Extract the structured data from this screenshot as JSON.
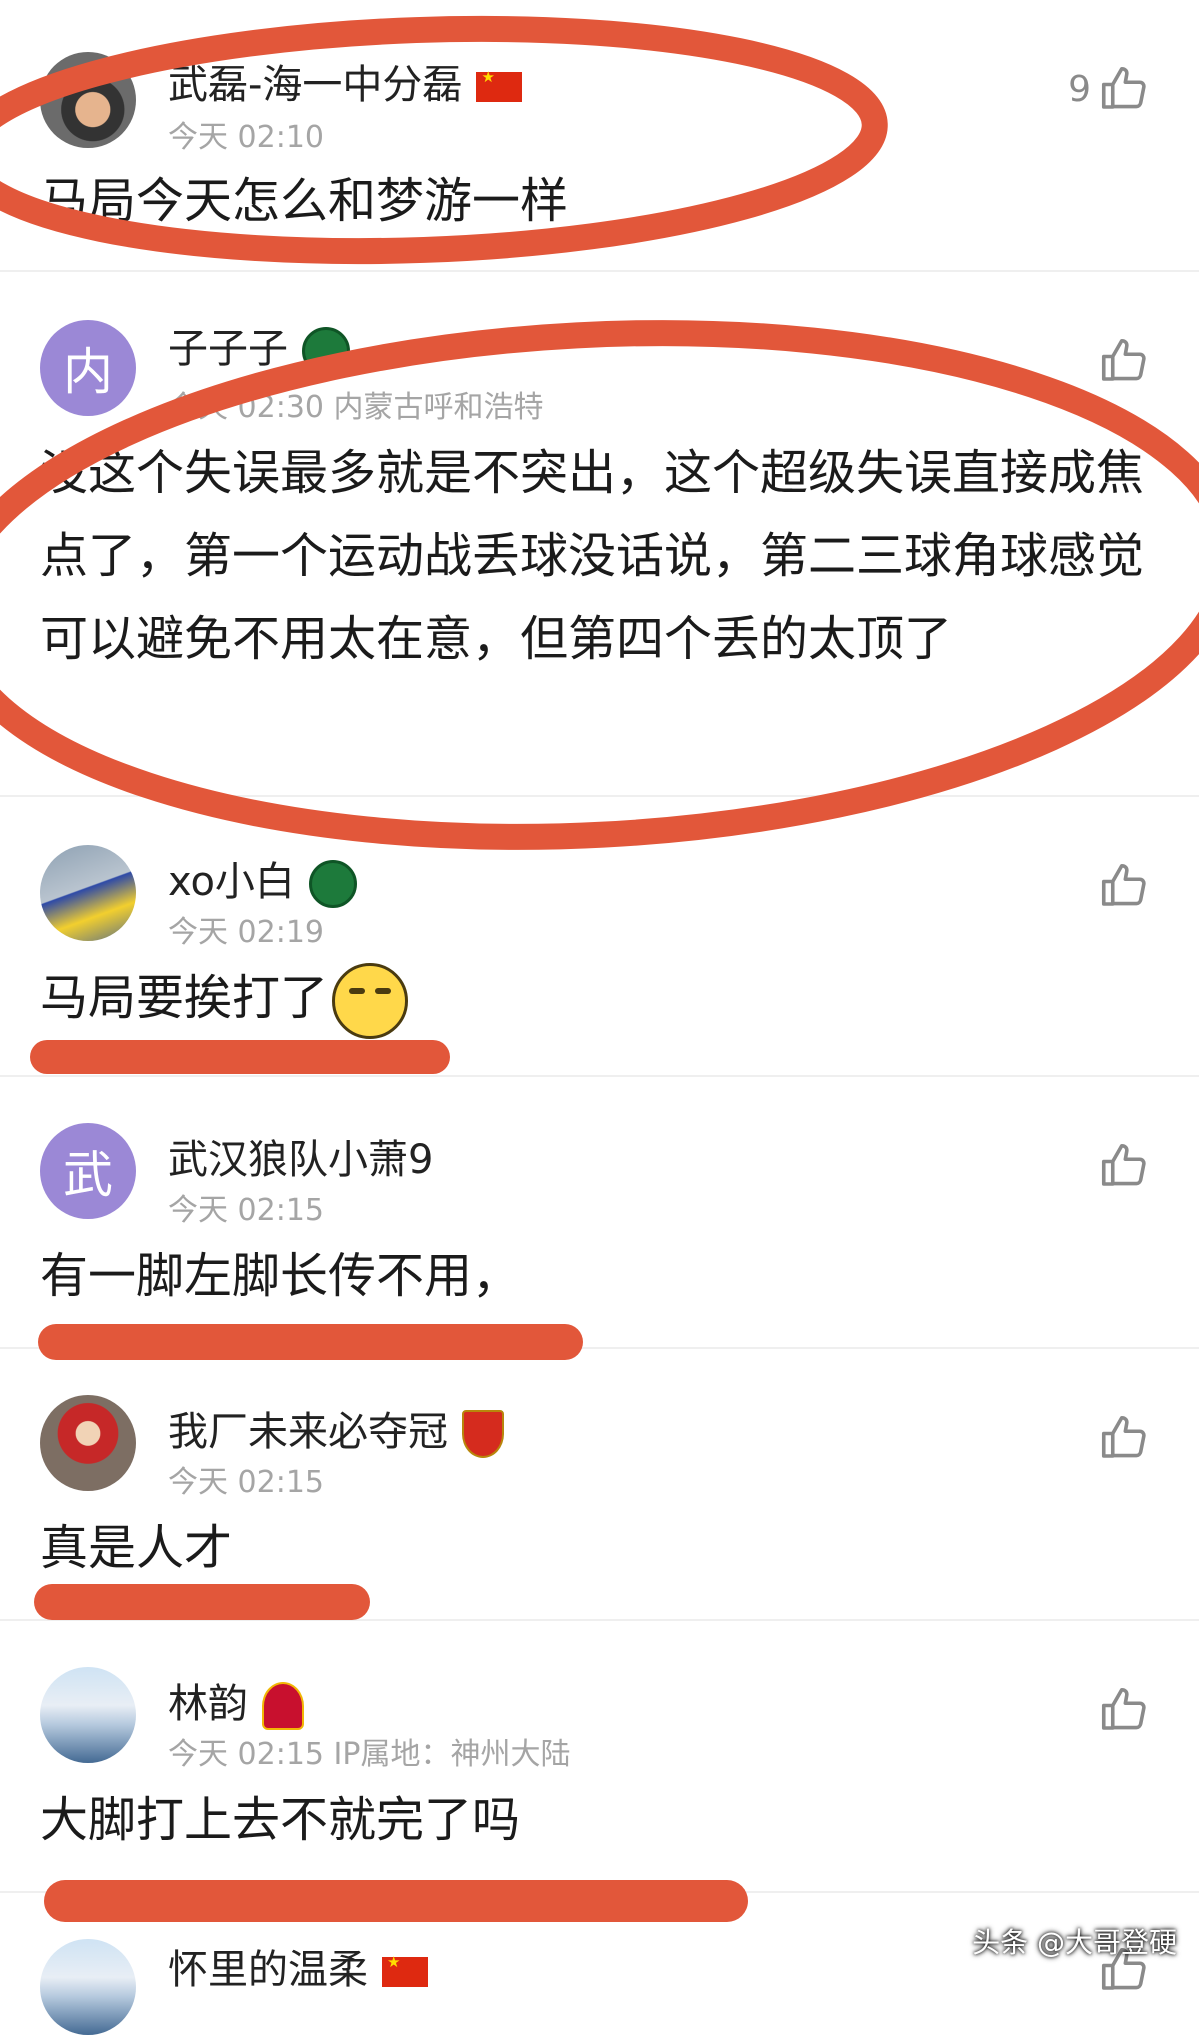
{
  "comments": [
    {
      "username": "武磊-海一中分磊",
      "meta": "今天 02:10",
      "text": "马局今天怎么和梦游一样",
      "likes": "9",
      "badge": "flag-cn-icon"
    },
    {
      "avatar_letter": "内",
      "username": "子子子",
      "meta": "今天 02:30 内蒙古呼和浩特",
      "text": "没这个失误最多就是不突出，这个超级失误直接成焦点了，第一个运动战丢球没话说，第二三球角球感觉可以避免不用太在意，但第四个丢的太顶了",
      "likes": "",
      "badge": "club-badge-icon"
    },
    {
      "username": "xo小白",
      "meta": "今天 02:19",
      "text": "马局要挨打了",
      "likes": "",
      "badge": "club-badge-icon"
    },
    {
      "avatar_letter": "武",
      "username": "武汉狼队小萧9",
      "meta": "今天 02:15",
      "text": "有一脚左脚长传不用，",
      "likes": ""
    },
    {
      "username": "我厂未来必夺冠",
      "meta": "今天 02:15",
      "text": "真是人才",
      "likes": "",
      "badge": "arsenal-badge-icon"
    },
    {
      "username": "林韵",
      "meta": "今天 02:15 IP属地：神州大陆",
      "text": "大脚打上去不就完了吗",
      "likes": "",
      "badge": "guangzhou-badge-icon"
    },
    {
      "username": "怀里的温柔",
      "badge": "flag-cn-icon"
    }
  ],
  "watermark": "头条 @大哥登硬",
  "colors": {
    "annotation": "#e2573a",
    "meta": "#a5a5a5",
    "divider": "#efefef"
  }
}
